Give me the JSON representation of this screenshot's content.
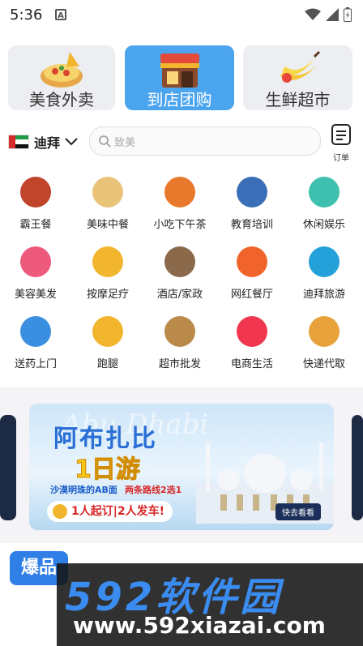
{
  "status_bar": {
    "time": "5:36",
    "notification_icon": "A"
  },
  "categories": [
    {
      "label": "美食外卖",
      "active": false,
      "icon": "pizza-icon"
    },
    {
      "label": "到店团购",
      "active": true,
      "icon": "storefront-icon"
    },
    {
      "label": "生鲜超市",
      "active": false,
      "icon": "bananas-icon"
    }
  ],
  "location": {
    "city": "迪拜",
    "flag": "uae-flag-icon"
  },
  "search": {
    "placeholder": "致美"
  },
  "order": {
    "label": "订单"
  },
  "services": [
    {
      "label": "霸王餐",
      "icon": "steak-icon",
      "color": "#c0452a"
    },
    {
      "label": "美味中餐",
      "icon": "dumplings-icon",
      "color": "#e9c37a"
    },
    {
      "label": "小吃下午茶",
      "icon": "burger-icon",
      "color": "#e8782c"
    },
    {
      "label": "教育培训",
      "icon": "graduation-icon",
      "color": "#3a6fb8"
    },
    {
      "label": "休闲娱乐",
      "icon": "pool-icon",
      "color": "#3fbfae"
    },
    {
      "label": "美容美发",
      "icon": "beauty-icon",
      "color": "#ee5a7c"
    },
    {
      "label": "按摩足疗",
      "icon": "massage-icon",
      "color": "#f2b62e"
    },
    {
      "label": "酒店/家政",
      "icon": "hotel-icon",
      "color": "#8a6a4a"
    },
    {
      "label": "网红餐厅",
      "icon": "camera-icon",
      "color": "#f0642c"
    },
    {
      "label": "迪拜旅游",
      "icon": "palm-island-icon",
      "color": "#24a1d8"
    },
    {
      "label": "送药上门",
      "icon": "medkit-icon",
      "color": "#3a8fe0"
    },
    {
      "label": "跑腿",
      "icon": "runner-icon",
      "color": "#f2b62e"
    },
    {
      "label": "超市批发",
      "icon": "warehouse-icon",
      "color": "#b98a4a"
    },
    {
      "label": "电商生活",
      "icon": "shopping-bag-icon",
      "color": "#f0374f"
    },
    {
      "label": "快递代取",
      "icon": "courier-icon",
      "color": "#e7a23c"
    }
  ],
  "banner": {
    "watermark": "Abu Dhabi",
    "title": "阿布扎比",
    "subtitle": "1日游",
    "tagline_left": "沙漠明珠的AB面",
    "tagline_right": "两条路线2选1",
    "promo": "1人起订|2人发车!",
    "cta": "快去看看"
  },
  "hot_tab": {
    "label": "爆品"
  },
  "watermark": {
    "brand": "592软件园",
    "url": "www.592xiazai.com"
  }
}
